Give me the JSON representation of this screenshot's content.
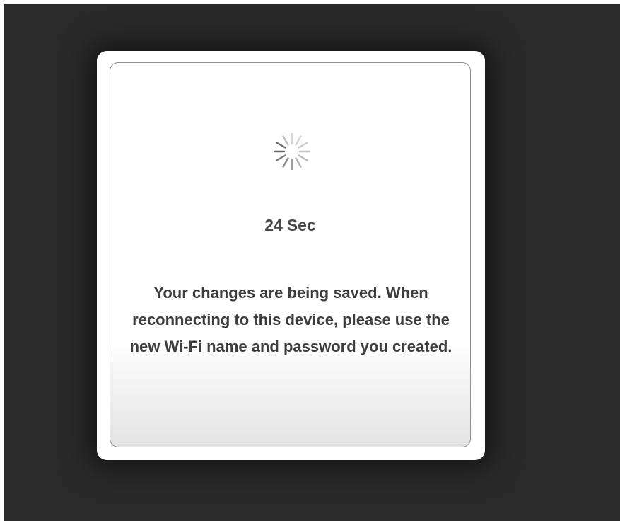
{
  "dialog": {
    "spinner_icon": "loading-spinner-icon",
    "countdown_value": "24",
    "countdown_unit": "Sec",
    "message": "Your changes are being saved. When reconnecting to this device, please use the new Wi-Fi name and password you created.",
    "colors": {
      "backdrop": "#2a2a2a",
      "text": "#3d3d3d",
      "border": "#8f8f8f"
    }
  }
}
